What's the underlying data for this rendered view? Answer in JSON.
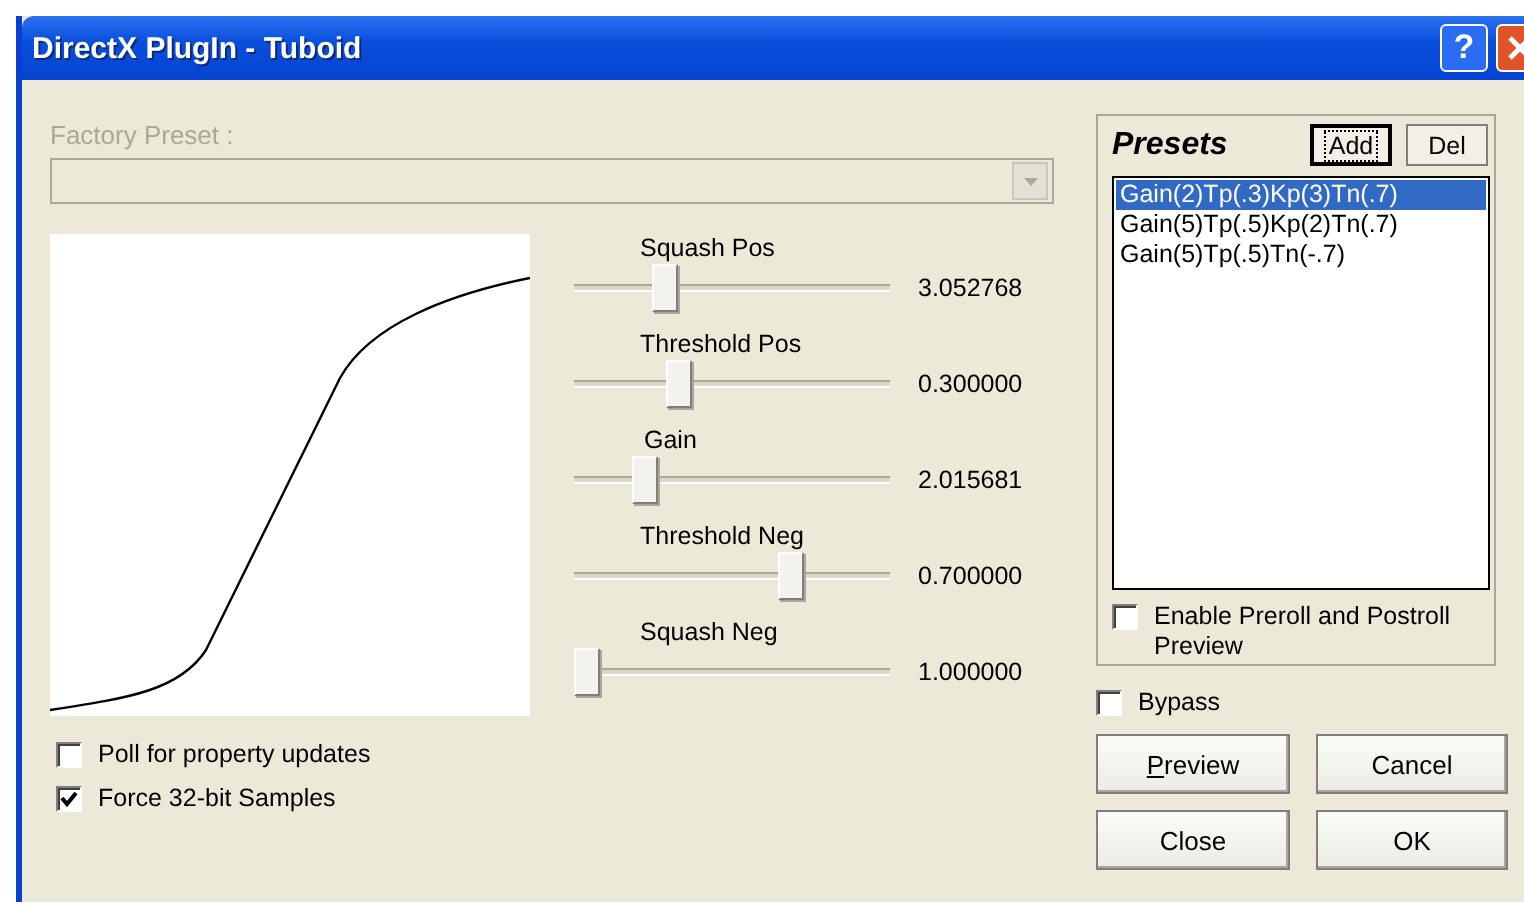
{
  "window": {
    "title": "DirectX PlugIn - Tuboid",
    "help_button": "?"
  },
  "factory_preset": {
    "label": "Factory Preset :",
    "disabled": true
  },
  "sliders": [
    {
      "label": "Squash Pos",
      "value": "3.052768",
      "level": 0.27
    },
    {
      "label": "Threshold Pos",
      "value": "0.300000",
      "level": 0.32
    },
    {
      "label": "Gain",
      "value": "2.015681",
      "level": 0.2
    },
    {
      "label": "Threshold Neg",
      "value": "0.700000",
      "level": 0.7
    },
    {
      "label": "Squash Neg",
      "value": "1.000000",
      "level": 0
    }
  ],
  "options": [
    {
      "label": "Poll for property updates",
      "checked": false
    },
    {
      "label": "Force 32-bit Samples",
      "checked": true
    }
  ],
  "presets": {
    "title": "Presets",
    "buttons": [
      {
        "label": "Add",
        "focused": true
      },
      {
        "label": "Del",
        "focused": false
      }
    ],
    "items": [
      {
        "label": "Gain(2)Tp(.3)Kp(3)Tn(.7)",
        "selected": true
      },
      {
        "label": "Gain(5)Tp(.5)Kp(2)Tn(.7)",
        "selected": false
      },
      {
        "label": "Gain(5)Tp(.5)Tn(-.7)",
        "selected": false
      }
    ],
    "preroll": {
      "label": "Enable Preroll and Postroll Preview",
      "checked": false
    }
  },
  "bypass": {
    "label": "Bypass",
    "checked": false
  },
  "buttons": [
    {
      "label": "Preview",
      "underline_first": true
    },
    {
      "label": "Cancel",
      "underline_first": false
    },
    {
      "label": "Close",
      "underline_first": false
    },
    {
      "label": "OK",
      "underline_first": false
    }
  ]
}
